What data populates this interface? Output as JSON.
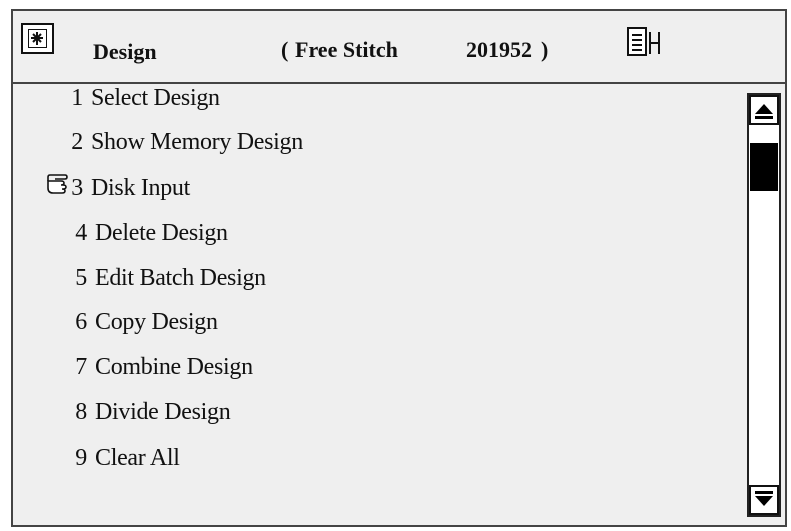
{
  "title": {
    "label": "Design",
    "paren_open": "(",
    "mode": "Free Stitch",
    "code": "201952",
    "paren_close": ")"
  },
  "menu": {
    "selected_index": 2,
    "items": [
      {
        "num": "1",
        "label": "Select Design"
      },
      {
        "num": "2",
        "label": "Show Memory Design"
      },
      {
        "num": "3",
        "label": "Disk Input"
      },
      {
        "num": "4",
        "label": "Delete Design"
      },
      {
        "num": "5",
        "label": "Edit Batch Design"
      },
      {
        "num": "6",
        "label": "Copy Design"
      },
      {
        "num": "7",
        "label": "Combine Design"
      },
      {
        "num": "8",
        "label": "Divide Design"
      },
      {
        "num": "9",
        "label": "Clear All"
      }
    ]
  },
  "icons": {
    "app": "app-menu-icon",
    "doc": "document-list-icon",
    "pointer": "hand-pointer-icon",
    "scroll_up": "triangle-up-icon",
    "scroll_down": "triangle-down-icon"
  },
  "colors": {
    "background": "#efefef",
    "border": "#444444",
    "thumb": "#000000"
  }
}
